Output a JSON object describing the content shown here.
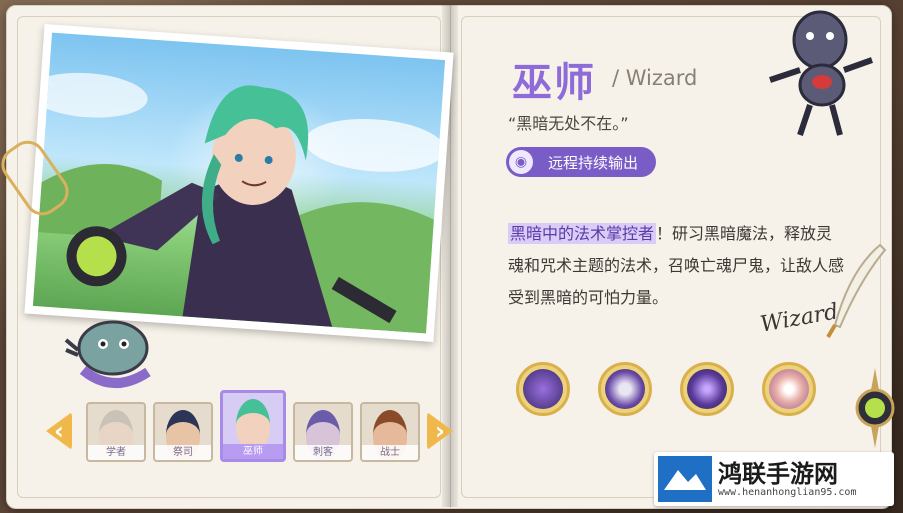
{
  "class": {
    "name_zh": "巫师",
    "name_en": "/ Wizard",
    "quote": "“黑暗无处不在。”",
    "role_tag": "远程持续输出",
    "description_highlight": "黑暗中的法术掌控者",
    "description_rest": "！研习黑暗魔法，释放灵魂和咒术主题的法术，召唤亡魂尸鬼，让敌人感受到黑暗的可怕力量。",
    "signature": "Wizard"
  },
  "portraits": [
    {
      "name": "学者",
      "active": false
    },
    {
      "name": "祭司",
      "active": false
    },
    {
      "name": "巫师",
      "active": true
    },
    {
      "name": "刺客",
      "active": false
    },
    {
      "name": "战士",
      "active": false
    }
  ],
  "nav": {
    "prev": "‹",
    "next": "›"
  },
  "skills": [
    {
      "icon": "shadow-spirit-skill-icon"
    },
    {
      "icon": "dark-orb-skill-icon"
    },
    {
      "icon": "ghoul-summon-skill-icon"
    },
    {
      "icon": "curse-cards-skill-icon"
    }
  ],
  "watermark": {
    "title": "鸿联手游网",
    "url": "www.henanhonglian95.com"
  },
  "colors": {
    "accent": "#8e6bd8",
    "tag_bg": "#7a5cc6",
    "arrow": "#f0b84a",
    "page": "#f6f2e9"
  }
}
